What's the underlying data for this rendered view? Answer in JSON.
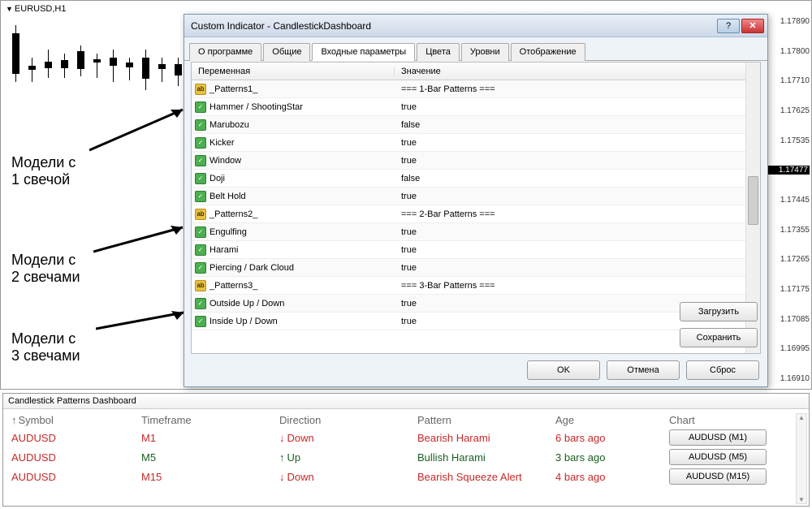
{
  "chart": {
    "symbol": "EURUSD,H1",
    "price_ticks": [
      "1.17890",
      "1.17800",
      "1.17710",
      "1.17625",
      "1.17535",
      "1.17477",
      "1.17445",
      "1.17355",
      "1.17265",
      "1.17175",
      "1.17085",
      "1.16995",
      "1.16910"
    ],
    "highlighted_price": "1.17477"
  },
  "annotations": {
    "a1": "Модели с\n1 свечой",
    "a2": "Модели с\n2 свечами",
    "a3": "Модели с\n3 свечами"
  },
  "dialog": {
    "title": "Custom Indicator - CandlestickDashboard",
    "tabs": [
      "О программе",
      "Общие",
      "Входные параметры",
      "Цвета",
      "Уровни",
      "Отображение"
    ],
    "active_tab": 2,
    "columns": {
      "var": "Переменная",
      "val": "Значение"
    },
    "rows": [
      {
        "icon": "ab",
        "name": "_Patterns1_",
        "value": "=== 1-Bar Patterns ==="
      },
      {
        "icon": "bool",
        "name": "Hammer / ShootingStar",
        "value": "true"
      },
      {
        "icon": "bool",
        "name": "Marubozu",
        "value": "false"
      },
      {
        "icon": "bool",
        "name": "Kicker",
        "value": "true"
      },
      {
        "icon": "bool",
        "name": "Window",
        "value": "true"
      },
      {
        "icon": "bool",
        "name": "Doji",
        "value": "false"
      },
      {
        "icon": "bool",
        "name": "Belt Hold",
        "value": "true"
      },
      {
        "icon": "ab",
        "name": "_Patterns2_",
        "value": "=== 2-Bar Patterns ==="
      },
      {
        "icon": "bool",
        "name": "Engulfing",
        "value": "true"
      },
      {
        "icon": "bool",
        "name": "Harami",
        "value": "true"
      },
      {
        "icon": "bool",
        "name": "Piercing / Dark Cloud",
        "value": "true"
      },
      {
        "icon": "ab",
        "name": "_Patterns3_",
        "value": "=== 3-Bar Patterns ==="
      },
      {
        "icon": "bool",
        "name": "Outside Up / Down",
        "value": "true"
      },
      {
        "icon": "bool",
        "name": "Inside Up / Down",
        "value": "true"
      }
    ],
    "buttons": {
      "load": "Загрузить",
      "save": "Сохранить",
      "ok": "OK",
      "cancel": "Отмена",
      "reset": "Сброс"
    }
  },
  "dashboard": {
    "title": "Candlestick Patterns Dashboard",
    "headers": {
      "symbol": "Symbol",
      "timeframe": "Timeframe",
      "direction": "Direction",
      "pattern": "Pattern",
      "age": "Age",
      "chart": "Chart"
    },
    "rows": [
      {
        "symbol": "AUDUSD",
        "tf": "M1",
        "dir": "Down",
        "dir_class": "red dir-down",
        "pattern": "Bearish Harami",
        "pat_class": "red",
        "age": "6 bars ago",
        "age_class": "red",
        "btn": "AUDUSD (M1)"
      },
      {
        "symbol": "AUDUSD",
        "tf": "M5",
        "dir": "Up",
        "dir_class": "green dir-up",
        "pattern": "Bullish Harami",
        "pat_class": "green",
        "age": "3 bars ago",
        "age_class": "green",
        "btn": "AUDUSD (M5)"
      },
      {
        "symbol": "AUDUSD",
        "tf": "M15",
        "dir": "Down",
        "dir_class": "red dir-down",
        "pattern": "Bearish Squeeze Alert",
        "pat_class": "red",
        "age": "4 bars ago",
        "age_class": "red",
        "btn": "AUDUSD (M15)"
      }
    ]
  }
}
